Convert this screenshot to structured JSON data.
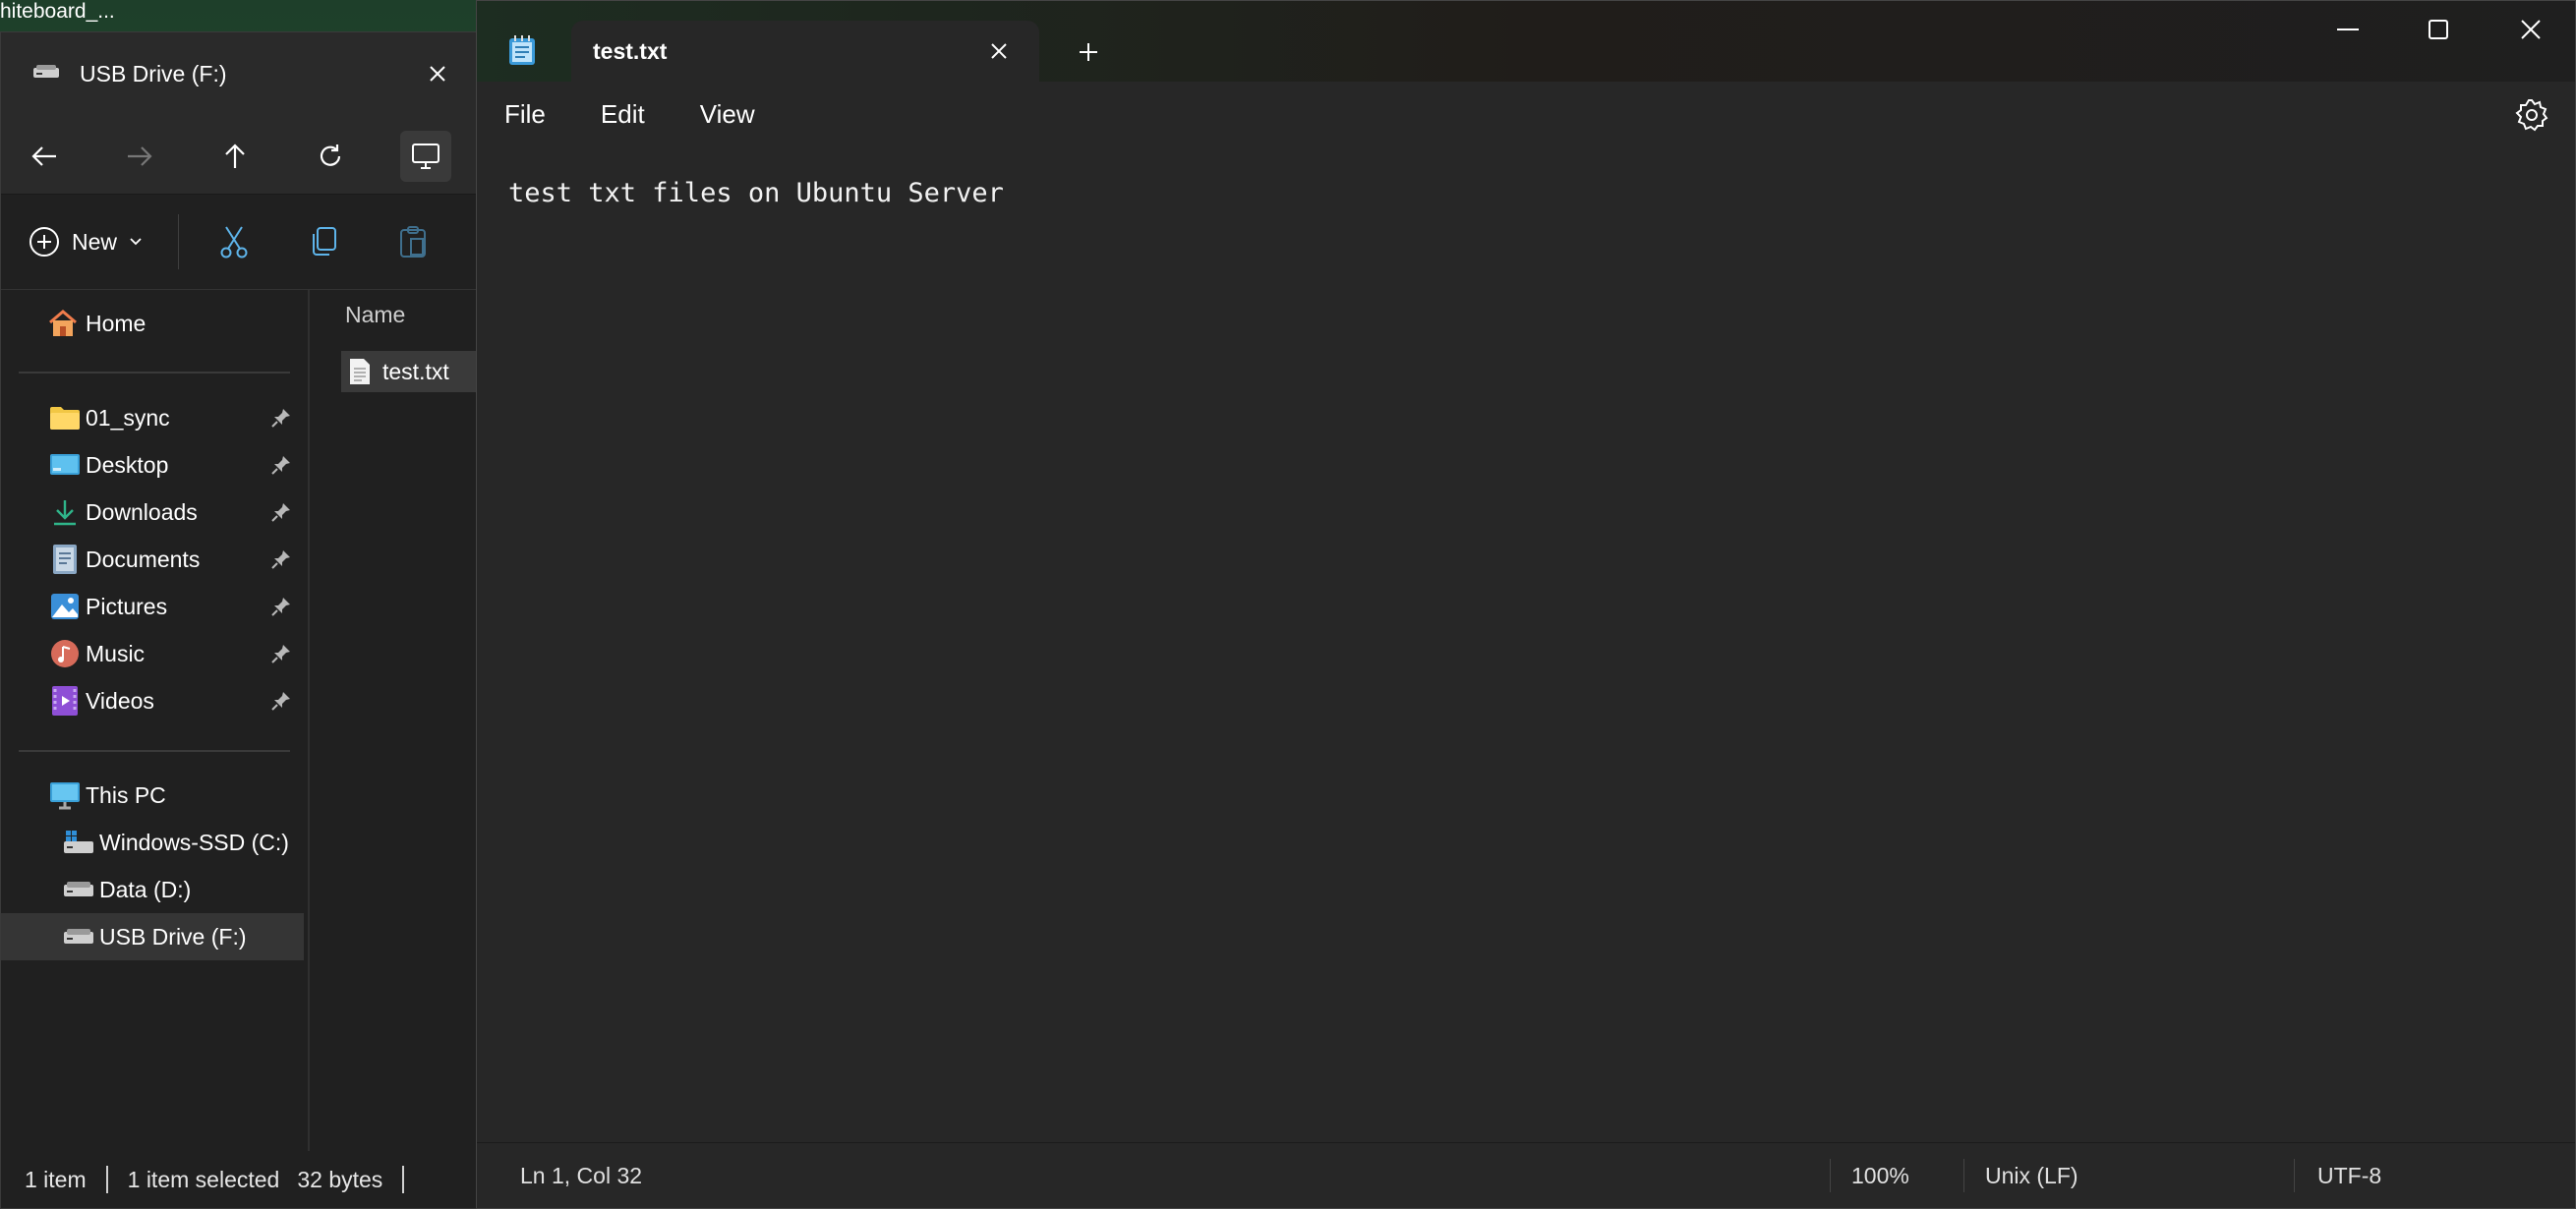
{
  "desktop": {
    "label": "hiteboard_..."
  },
  "explorer": {
    "tab_title": "USB Drive (F:)",
    "toolbar": {
      "new_label": "New"
    },
    "sidebar": {
      "home": "Home",
      "quick_access": [
        {
          "label": "01_sync",
          "icon": "folder-icon"
        },
        {
          "label": "Desktop",
          "icon": "desktop-icon"
        },
        {
          "label": "Downloads",
          "icon": "download-icon"
        },
        {
          "label": "Documents",
          "icon": "documents-icon"
        },
        {
          "label": "Pictures",
          "icon": "pictures-icon"
        },
        {
          "label": "Music",
          "icon": "music-icon"
        },
        {
          "label": "Videos",
          "icon": "videos-icon"
        }
      ],
      "this_pc": "This PC",
      "drives": [
        {
          "label": "Windows-SSD (C:)"
        },
        {
          "label": "Data (D:)"
        },
        {
          "label": "USB Drive (F:)",
          "selected": true
        }
      ]
    },
    "files": {
      "column_name": "Name",
      "items": [
        {
          "name": "test.txt"
        }
      ]
    },
    "status": {
      "count": "1 item",
      "selected": "1 item selected",
      "size": "32 bytes"
    }
  },
  "notepad": {
    "tab_title": "test.txt",
    "menu": {
      "file": "File",
      "edit": "Edit",
      "view": "View"
    },
    "content": "test txt files on Ubuntu Server",
    "status": {
      "position": "Ln 1, Col 32",
      "zoom": "100%",
      "line_ending": "Unix (LF)",
      "encoding": "UTF-8"
    }
  },
  "colors": {
    "accent_blue": "#4aa3df",
    "folder_yellow": "#f2c744"
  }
}
